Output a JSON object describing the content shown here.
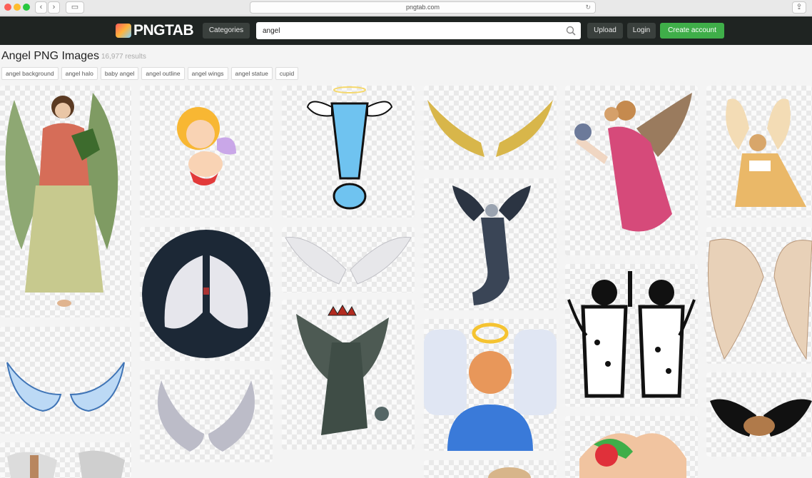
{
  "browser": {
    "back_label": "‹",
    "forward_label": "›",
    "url": "pngtab.com",
    "share_label": "⇪"
  },
  "header": {
    "logo_text": "PNGTAB",
    "categories_label": "Categories",
    "search_value": "angel",
    "upload_label": "Upload",
    "login_label": "Login",
    "create_label": "Create account"
  },
  "page": {
    "title": "Angel PNG Images",
    "result_count": "16,977 results"
  },
  "tags": [
    "angel background",
    "angel halo",
    "baby angel",
    "angel outline",
    "angel wings",
    "angel statue",
    "cupid"
  ],
  "colors": {
    "navbar": "#1f2422",
    "accent_green": "#3fae49",
    "nav_button": "#3a403d"
  },
  "images": [
    {
      "name": "vintage-angel-green-robe"
    },
    {
      "name": "cupid-cartoon"
    },
    {
      "name": "exclamation-mark-wings-halo"
    },
    {
      "name": "golden-wings"
    },
    {
      "name": "angel-embracing-child"
    },
    {
      "name": "angel-with-book"
    },
    {
      "name": "white-wings-dark-circle"
    },
    {
      "name": "white-wings-spread"
    },
    {
      "name": "dark-angel-statue"
    },
    {
      "name": "beige-wings"
    },
    {
      "name": "blue-outline-wings"
    },
    {
      "name": "angel-statue-crown"
    },
    {
      "name": "angel-icon-halo"
    },
    {
      "name": "angel-silhouettes-candle"
    },
    {
      "name": "grey-wings"
    },
    {
      "name": "black-wings-hands"
    },
    {
      "name": "angel-wings-figure"
    },
    {
      "name": "ribbon-bow"
    }
  ]
}
